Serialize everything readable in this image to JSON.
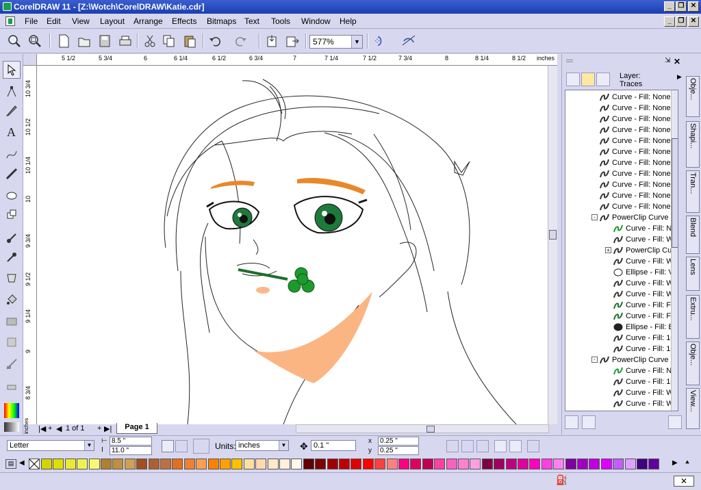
{
  "window": {
    "title": "CorelDRAW 11 - [Z:\\Wotch\\CorelDRAW\\Katie.cdr]",
    "controls": {
      "minimize": "_",
      "restore": "❐",
      "close": "✕"
    }
  },
  "menu": {
    "items": [
      "File",
      "Edit",
      "View",
      "Layout",
      "Arrange",
      "Effects",
      "Bitmaps",
      "Text",
      "Tools",
      "Window",
      "Help"
    ]
  },
  "toolbar": {
    "zoom_value": "577%",
    "icons": [
      "zoom-icon",
      "zoom-fit-icon",
      "new-icon",
      "open-icon",
      "save-icon",
      "print-icon",
      "cut-icon",
      "copy-icon",
      "paste-icon",
      "undo-icon",
      "redo-icon",
      "import-icon",
      "export-icon",
      "snap-icon",
      "launcher-icon"
    ]
  },
  "ruler": {
    "h_labels": [
      "5 1/2",
      "5 3/4",
      "6",
      "6 1/4",
      "6 1/2",
      "6 3/4",
      "7",
      "7 1/4",
      "7 1/2",
      "7 3/4",
      "8",
      "8 1/4",
      "8 1/2",
      "inches"
    ],
    "v_labels": [
      "10 3/4",
      "10 1/2",
      "10 1/4",
      "10",
      "9 3/4",
      "9 1/2",
      "9 1/4",
      "9",
      "8 3/4"
    ],
    "corner_unit": "inches"
  },
  "docbar": {
    "page_count": "1 of 1",
    "page_tab": "Page 1"
  },
  "docker": {
    "layer_label": "Layer:",
    "layer_name": "Traces",
    "tree": [
      {
        "text": "Curve - Fill: None",
        "indent": 1,
        "icon": "curve"
      },
      {
        "text": "Curve - Fill: None",
        "indent": 1,
        "icon": "curve"
      },
      {
        "text": "Curve - Fill: None",
        "indent": 1,
        "icon": "curve"
      },
      {
        "text": "Curve - Fill: None",
        "indent": 1,
        "icon": "curve"
      },
      {
        "text": "Curve - Fill: None",
        "indent": 1,
        "icon": "curve"
      },
      {
        "text": "Curve - Fill: None",
        "indent": 1,
        "icon": "curve"
      },
      {
        "text": "Curve - Fill: None",
        "indent": 1,
        "icon": "curve"
      },
      {
        "text": "Curve - Fill: None",
        "indent": 1,
        "icon": "curve"
      },
      {
        "text": "Curve - Fill: None",
        "indent": 1,
        "icon": "curve"
      },
      {
        "text": "Curve - Fill: None",
        "indent": 1,
        "icon": "curve"
      },
      {
        "text": "Curve - Fill: None",
        "indent": 1,
        "icon": "curve"
      },
      {
        "text": "PowerClip Curve",
        "indent": 1,
        "icon": "curve",
        "expander": "-"
      },
      {
        "text": "Curve - Fill: N",
        "indent": 2,
        "icon": "curve-green"
      },
      {
        "text": "Curve - Fill: W",
        "indent": 2,
        "icon": "curve"
      },
      {
        "text": "PowerClip Cu",
        "indent": 2,
        "icon": "curve",
        "expander": "+"
      },
      {
        "text": "Curve - Fill: W",
        "indent": 2,
        "icon": "curve"
      },
      {
        "text": "Ellipse - Fill: V",
        "indent": 2,
        "icon": "ellipse"
      },
      {
        "text": "Curve - Fill: W",
        "indent": 2,
        "icon": "curve"
      },
      {
        "text": "Curve - Fill: W",
        "indent": 2,
        "icon": "curve"
      },
      {
        "text": "Curve - Fill: Fo",
        "indent": 2,
        "icon": "curve-darkgreen"
      },
      {
        "text": "Curve - Fill: Fo",
        "indent": 2,
        "icon": "curve-darkgreen"
      },
      {
        "text": "Ellipse - Fill: B",
        "indent": 2,
        "icon": "ellipse-black"
      },
      {
        "text": "Curve - Fill: 10",
        "indent": 2,
        "icon": "curve"
      },
      {
        "text": "Curve - Fill: 10",
        "indent": 2,
        "icon": "curve"
      },
      {
        "text": "PowerClip Curve",
        "indent": 1,
        "icon": "curve",
        "expander": "-"
      },
      {
        "text": "Curve - Fill: N",
        "indent": 2,
        "icon": "curve-green"
      },
      {
        "text": "Curve - Fill: 10",
        "indent": 2,
        "icon": "curve"
      },
      {
        "text": "Curve - Fill: W",
        "indent": 2,
        "icon": "curve"
      },
      {
        "text": "Curve - Fill: W",
        "indent": 2,
        "icon": "curve"
      }
    ]
  },
  "docker_tabs": [
    "Obje...",
    "Shapi...",
    "Tran...",
    "Blend",
    "Lens",
    "Extru...",
    "Obje...",
    "View..."
  ],
  "property_bar": {
    "paper": "Letter",
    "width": "8.5 \"",
    "height": "11.0 \"",
    "units_label": "Units:",
    "units_value": "inches",
    "nudge": "0.1 \"",
    "dup_x": "0.25 \"",
    "dup_y": "0.25 \""
  },
  "palette": {
    "colors": [
      "#d4d400",
      "#e0e000",
      "#eaea30",
      "#f0f050",
      "#f8f870",
      "#b08030",
      "#c09040",
      "#d0a050",
      "#a05020",
      "#b06030",
      "#c07040",
      "#e07020",
      "#f08030",
      "#f8a050",
      "#ff8000",
      "#ffa000",
      "#ffc000",
      "#ffe0a0",
      "#ffd8b0",
      "#ffe8c8",
      "#fff0dc",
      "#fff8ec",
      "#600000",
      "#800000",
      "#a00000",
      "#c00000",
      "#e00000",
      "#ff0000",
      "#ff4040",
      "#ff8080",
      "#ff0080",
      "#e00060",
      "#c00050",
      "#ff40a0",
      "#ff60c0",
      "#ff80d0",
      "#ffa0e0",
      "#800040",
      "#a00060",
      "#c00080",
      "#e000a0",
      "#ff00c0",
      "#ff40e0",
      "#ff80f0",
      "#8000a0",
      "#a000c0",
      "#c000e0",
      "#e000ff",
      "#c060ff",
      "#e0a0ff",
      "#400080",
      "#6000a0"
    ]
  },
  "status": {}
}
